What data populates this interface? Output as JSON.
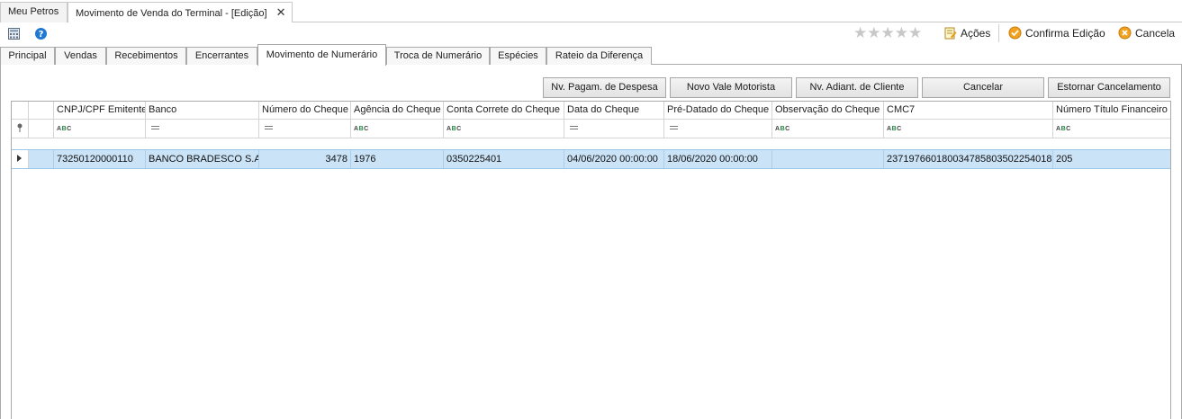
{
  "doc_tabs": [
    {
      "label": "Meu Petros"
    },
    {
      "label": "Movimento de Venda do Terminal - [Edição]",
      "close": "✕"
    }
  ],
  "toolbar": {
    "stars": "★★★★★",
    "acoes": "Ações",
    "confirma": "Confirma Edição",
    "cancela": "Cancela"
  },
  "tabs": [
    "Principal",
    "Vendas",
    "Recebimentos",
    "Encerrantes",
    "Movimento de Numerário",
    "Troca de Numerário",
    "Espécies",
    "Rateio da Diferença"
  ],
  "actions": [
    "Nv. Pagam. de Despesa",
    "Novo Vale Motorista",
    "Nv. Adiant. de Cliente",
    "Cancelar",
    "Estornar Cancelamento"
  ],
  "grid": {
    "columns": [
      "CNPJ/CPF Emitente",
      "Banco",
      "Número do Cheque",
      "Agência do Cheque",
      "Conta Correte do Cheque",
      "Data do Cheque",
      "Pré-Datado do Cheque",
      "Observação do Cheque",
      "CMC7",
      "Número Título Financeiro"
    ],
    "filter_text": "ABC",
    "rows": [
      [
        "73250120000110",
        "BANCO BRADESCO S.A.",
        "3478",
        "1976",
        "0350225401",
        "04/06/2020 00:00:00",
        "18/06/2020 00:00:00",
        "",
        "237197660180034785803502254018",
        "205"
      ]
    ]
  },
  "colors": {
    "selected_row": "#cbe3f7",
    "accent_orange": "#f0a020"
  }
}
